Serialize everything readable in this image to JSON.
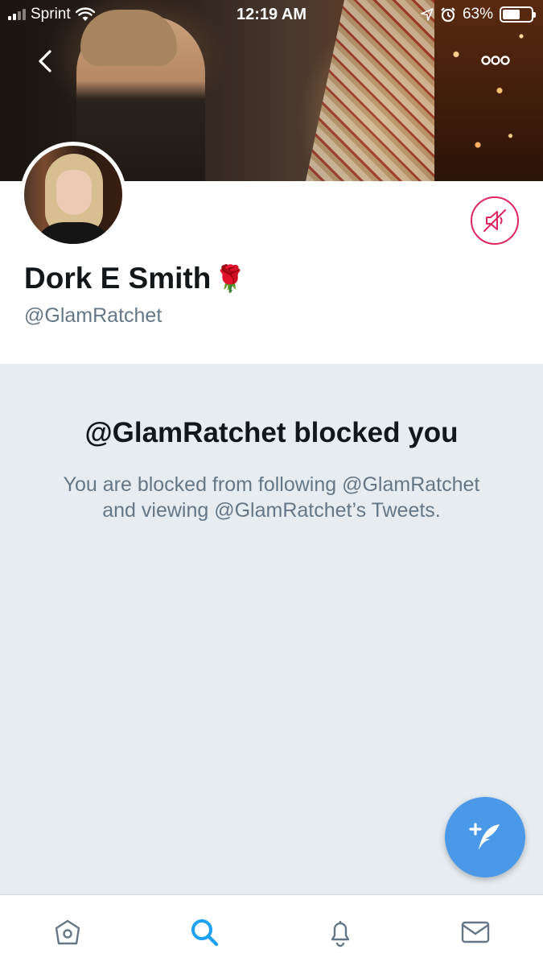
{
  "status_bar": {
    "carrier": "Sprint",
    "time": "12:19 AM",
    "battery_percent": "63%",
    "battery_level": 0.63
  },
  "header": {
    "back_icon": "chevron-left-icon",
    "more_icon": "more-dots-icon"
  },
  "profile": {
    "display_name": "Dork E Smith",
    "name_emoji": "🌹",
    "handle": "@GlamRatchet",
    "muted_icon": "speaker-muted-icon"
  },
  "blocked": {
    "title": "@GlamRatchet blocked you",
    "description": "You are blocked from following @GlamRatchet and viewing @GlamRatchet’s Tweets."
  },
  "compose": {
    "icon": "compose-tweet-icon"
  },
  "tabbar": {
    "items": [
      {
        "icon": "home-icon",
        "active": false
      },
      {
        "icon": "search-icon",
        "active": true
      },
      {
        "icon": "bell-icon",
        "active": false
      },
      {
        "icon": "mail-icon",
        "active": false
      }
    ]
  },
  "colors": {
    "accent": "#1da1f2",
    "compose": "#4a99e9",
    "mute": "#e0245e",
    "muted_text": "#657786",
    "background_gray": "#e6ecf0"
  }
}
